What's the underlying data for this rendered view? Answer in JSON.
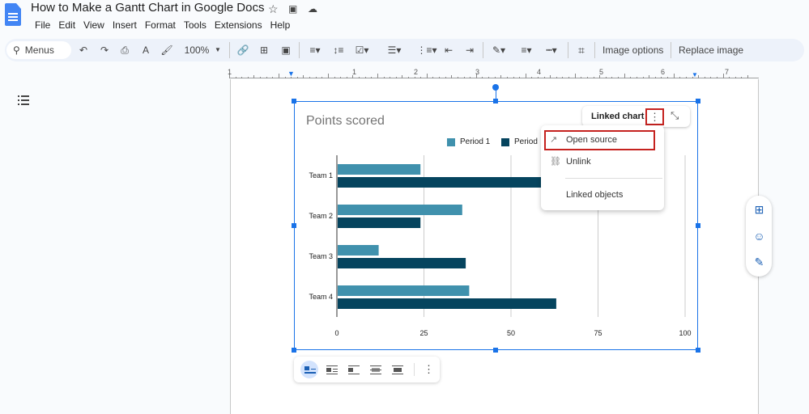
{
  "header": {
    "title": "How to Make a Gantt Chart in Google Docs",
    "title_icons": [
      "star-icon",
      "move-to-folder-icon",
      "cloud-saved-icon"
    ],
    "menu": [
      "File",
      "Edit",
      "View",
      "Insert",
      "Format",
      "Tools",
      "Extensions",
      "Help"
    ]
  },
  "toolbar": {
    "search_label": "Menus",
    "zoom_level": "100%",
    "image_options_label": "Image options",
    "replace_image_label": "Replace image"
  },
  "ruler": {
    "labels": [
      "1",
      "1",
      "2",
      "3",
      "4",
      "5",
      "6",
      "7"
    ]
  },
  "linked_chart": {
    "chip_label": "Linked chart",
    "menu_items": [
      "Open source",
      "Unlink",
      "Linked objects"
    ]
  },
  "chart_data": {
    "type": "bar",
    "orientation": "horizontal",
    "title": "Points scored",
    "categories": [
      "Team 1",
      "Team 2",
      "Team 3",
      "Team 4"
    ],
    "series": [
      {
        "name": "Period 1",
        "color": "#4091ad",
        "values": [
          24,
          36,
          12,
          38
        ]
      },
      {
        "name": "Period 2",
        "color": "#05445e",
        "values": [
          62,
          24,
          37,
          63
        ]
      }
    ],
    "xlim": [
      0,
      100
    ],
    "xticks": [
      "0",
      "25",
      "50",
      "75",
      "100"
    ],
    "grid": true,
    "legend_position": "top-right",
    "legend_visible_text": [
      "Period 1",
      "Period"
    ]
  },
  "colors": {
    "accent": "#1a73e8",
    "highlight_border": "#c5221f"
  }
}
